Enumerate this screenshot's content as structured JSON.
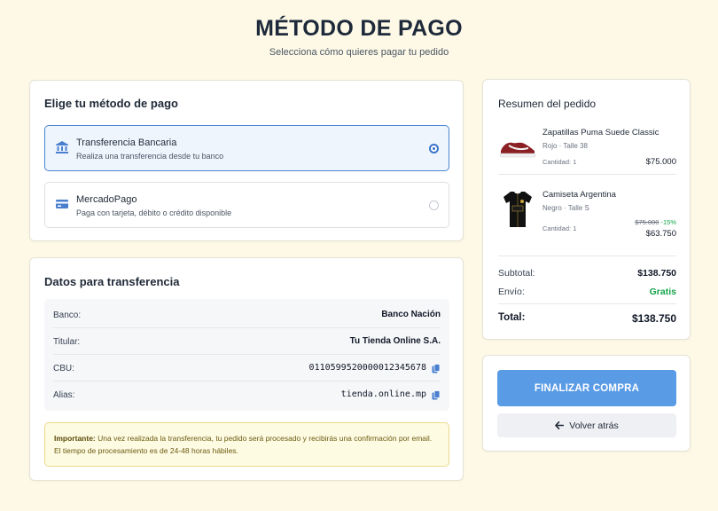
{
  "header": {
    "title": "MÉTODO DE PAGO",
    "subtitle": "Selecciona cómo quieres pagar tu pedido"
  },
  "payment_methods": {
    "title": "Elige tu método de pago",
    "selected": "transferencia",
    "options": [
      {
        "id": "transferencia",
        "label": "Transferencia Bancaria",
        "description": "Realiza una transferencia desde tu banco",
        "icon": "bank-icon",
        "selected": true
      },
      {
        "id": "mercadopago",
        "label": "MercadoPago",
        "description": "Paga con tarjeta, débito o crédito disponible",
        "icon": "card-icon",
        "selected": false
      }
    ]
  },
  "transfer": {
    "title": "Datos para transferencia",
    "rows": [
      {
        "label": "Banco:",
        "value": "Banco Nación",
        "copyable": false
      },
      {
        "label": "Titular:",
        "value": "Tu Tienda Online S.A.",
        "copyable": false
      },
      {
        "label": "CBU:",
        "value": "0110599520000012345678",
        "copyable": true
      },
      {
        "label": "Alias:",
        "value": "tienda.online.mp",
        "copyable": true
      }
    ],
    "notice_strong": "Importante:",
    "notice_text": " Una vez realizada la transferencia, tu pedido será procesado y recibirás una confirmación por email. El tiempo de procesamiento es de 24-48 horas hábiles."
  },
  "summary": {
    "title": "Resumen del pedido",
    "items": [
      {
        "name": "Zapatillas Puma Suede Classic",
        "color": "Rojo",
        "size": "Talle 38",
        "qty_label": "Cantidad: 1",
        "price": "$75.000"
      },
      {
        "name": "Camiseta Argentina",
        "color": "Negro",
        "size": "Talle S",
        "qty_label": "Cantidad: 1",
        "old_price": "$75.000",
        "discount": "-15%",
        "price": "$63.750"
      }
    ],
    "subtotal_label": "Subtotal:",
    "subtotal_value": "$138.750",
    "shipping_label": "Envío:",
    "shipping_value": "Gratis",
    "total_label": "Total:",
    "total_value": "$138.750"
  },
  "actions": {
    "primary_label": "FINALIZAR COMPRA",
    "back_label": "Volver atrás"
  },
  "colors": {
    "background": "#fdf9e6",
    "accent": "#5a9be6",
    "selected_border": "#4a83d4",
    "success": "#16a34a"
  }
}
